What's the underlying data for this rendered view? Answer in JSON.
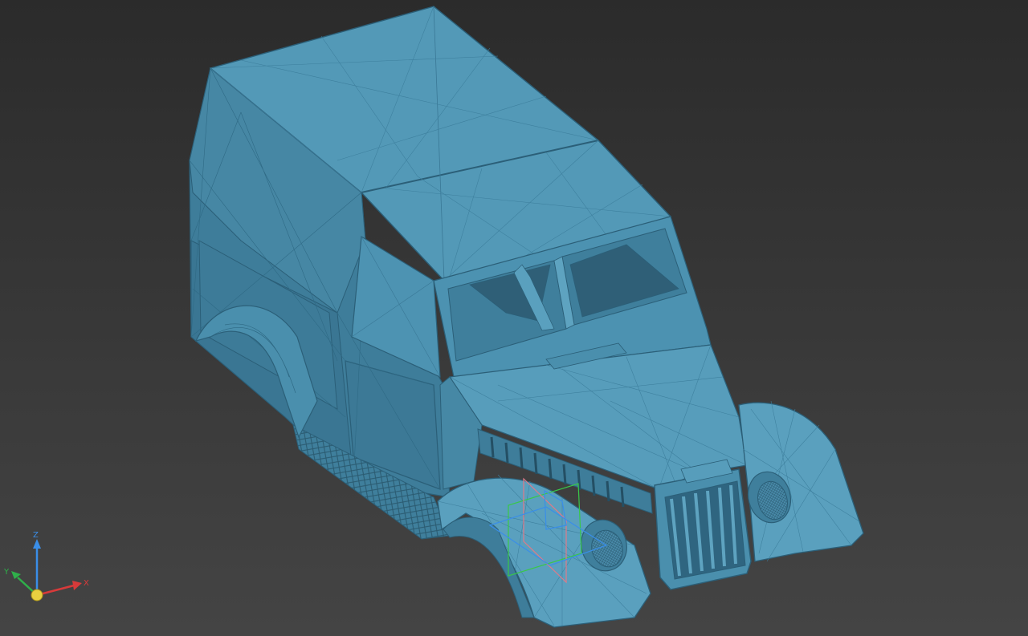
{
  "viewport": {
    "background_top": "#2b2b2b",
    "background_bottom": "#444444",
    "model": {
      "name": "",
      "display_mode": "shaded-with-mesh-edges",
      "fill_color": "#4f97b5",
      "edge_color": "#2b5f78"
    },
    "manipulator": {
      "x_color": "#e06060",
      "y_color": "#38c848",
      "z_color": "#3a8ee8"
    }
  },
  "axis_triad": {
    "x_label": "X",
    "y_label": "Y",
    "z_label": "Z",
    "x_color": "#d83a3a",
    "y_color": "#2fb04a",
    "z_color": "#3a8ee8",
    "origin_color": "#e8d040"
  }
}
